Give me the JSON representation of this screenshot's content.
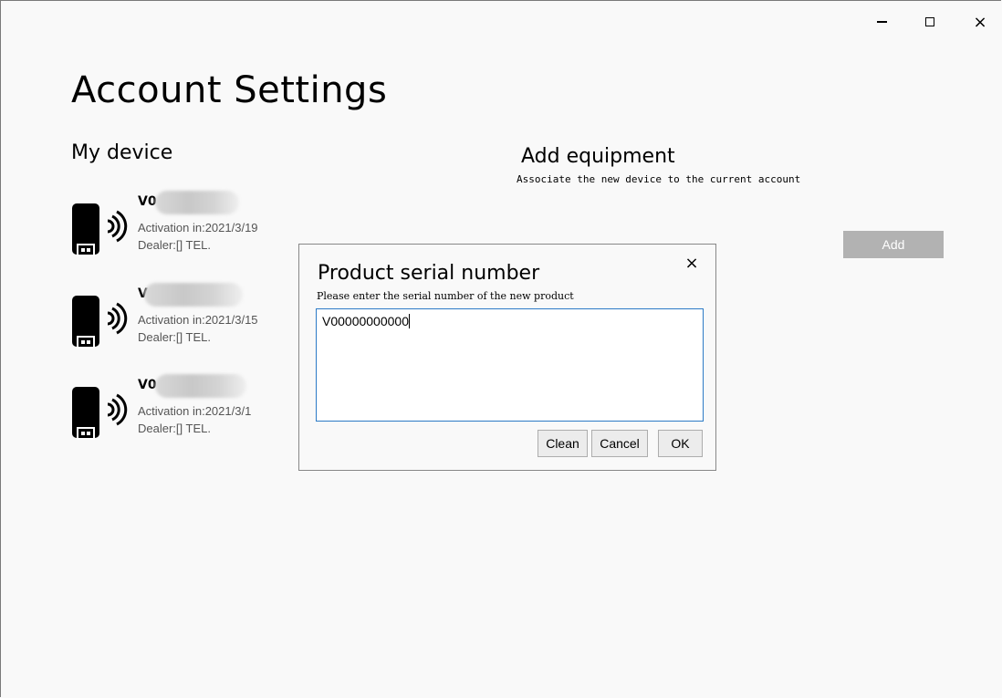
{
  "window": {
    "controls": {
      "minimize_icon": "minimize-icon",
      "maximize_icon": "maximize-icon",
      "close_glyph": "×"
    }
  },
  "page": {
    "title": "Account Settings"
  },
  "my_device": {
    "title": "My device",
    "devices": [
      {
        "name": "V0",
        "activation": "Activation in:2021/3/19",
        "dealer": "Dealer:[] TEL.",
        "icon": "usb-wireless-device-icon"
      },
      {
        "name": "V",
        "activation": "Activation in:2021/3/15",
        "dealer": "Dealer:[] TEL.",
        "icon": "usb-wireless-device-icon"
      },
      {
        "name": "V0",
        "activation": "Activation in:2021/3/1",
        "dealer": "Dealer:[] TEL.",
        "icon": "usb-wireless-device-icon"
      }
    ]
  },
  "add_equipment": {
    "title": "Add equipment",
    "subtitle": "Associate the new device to the current account",
    "add_button": "Add"
  },
  "dialog": {
    "title": "Product serial number",
    "close_glyph": "×",
    "subtitle": "Please enter the serial number of the new product",
    "input_value": "V00000000000",
    "buttons": {
      "clean": "Clean",
      "cancel": "Cancel",
      "ok": "OK"
    }
  },
  "colors": {
    "background": "#f9f9f9",
    "add_button": "#b2b2b2",
    "input_border": "#2c7ac6"
  }
}
